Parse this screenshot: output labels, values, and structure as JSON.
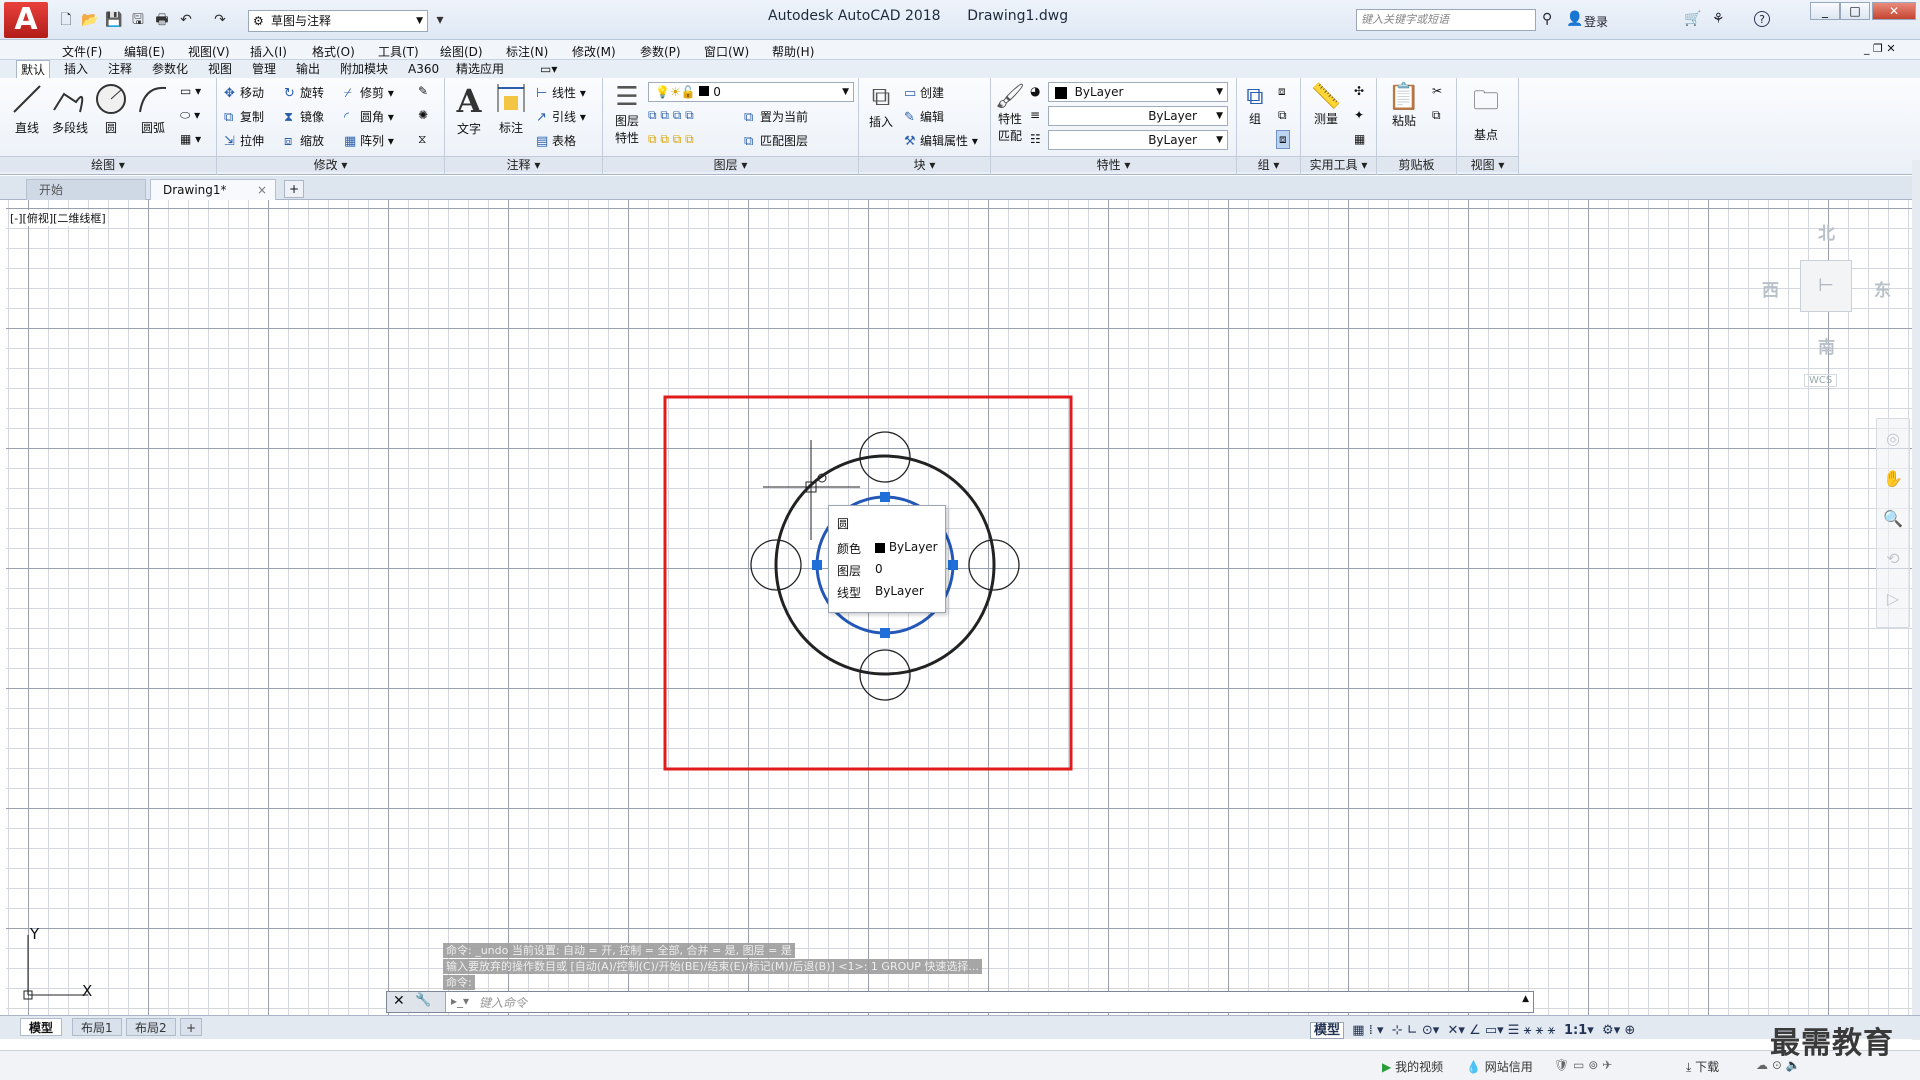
{
  "app": {
    "logo": "A",
    "title": "Autodesk AutoCAD 2018",
    "filename": "Drawing1.dwg",
    "workspace": "草图与注释",
    "search_placeholder": "键入关键字或短语",
    "login": "登录",
    "help": "?"
  },
  "menu": [
    "文件(F)",
    "编辑(E)",
    "视图(V)",
    "插入(I)",
    "格式(O)",
    "工具(T)",
    "绘图(D)",
    "标注(N)",
    "修改(M)",
    "参数(P)",
    "窗口(W)",
    "帮助(H)"
  ],
  "ribbon_tabs": [
    "默认",
    "插入",
    "注释",
    "参数化",
    "视图",
    "管理",
    "输出",
    "附加模块",
    "A360",
    "精选应用"
  ],
  "ribbon": {
    "draw": {
      "title": "绘图",
      "line": "直线",
      "polyline": "多段线",
      "circle": "圆",
      "arc": "圆弧"
    },
    "modify": {
      "title": "修改",
      "move": "移动",
      "rotate": "旋转",
      "trim": "修剪",
      "copy": "复制",
      "mirror": "镜像",
      "fillet": "圆角",
      "stretch": "拉伸",
      "scale": "缩放",
      "array": "阵列"
    },
    "annotation": {
      "title": "注释",
      "text": "文字",
      "dimension": "标注",
      "linear": "线性",
      "leader": "引线",
      "table": "表格"
    },
    "layers": {
      "title": "图层",
      "properties_line1": "图层",
      "properties_line2": "特性",
      "current_layer": "0",
      "make_current": "置为当前",
      "match_layer": "匹配图层"
    },
    "block": {
      "title": "块",
      "insert": "插入",
      "create": "创建",
      "edit": "编辑",
      "edit_attr": "编辑属性"
    },
    "properties": {
      "title": "特性",
      "match_line1": "特性",
      "match_line2": "匹配",
      "color": "ByLayer",
      "linetype": "ByLayer",
      "lineweight": "ByLayer"
    },
    "groups": {
      "title": "组",
      "group": "组"
    },
    "utilities": {
      "title": "实用工具",
      "measure": "测量"
    },
    "clipboard": {
      "title": "剪贴板",
      "paste": "粘贴"
    },
    "view": {
      "title": "视图",
      "base": "基点"
    }
  },
  "file_tabs": {
    "start": "开始",
    "drawing": "Drawing1*",
    "close": "×",
    "add": "+"
  },
  "viewport_label": "[-][俯视][二维线框]",
  "viewcube": {
    "north": "北",
    "south": "南",
    "east": "东",
    "west": "西",
    "wcs": "WCS"
  },
  "tooltip": {
    "title": "圆",
    "rows": [
      {
        "key": "颜色",
        "value": "ByLayer"
      },
      {
        "key": "图层",
        "value": "0"
      },
      {
        "key": "线型",
        "value": "ByLayer"
      }
    ]
  },
  "command": {
    "history": [
      "命令: _undo 当前设置: 自动 = 开, 控制 = 全部, 合并 = 是, 图层 = 是",
      "输入要放弃的操作数目或 [自动(A)/控制(C)/开始(BE)/结束(E)/标记(M)/后退(B)] <1>: 1 GROUP 快速选择...",
      "命令:"
    ],
    "placeholder": "键入命令"
  },
  "layout_tabs": [
    "模型",
    "布局1",
    "布局2"
  ],
  "status": {
    "model": "模型",
    "scale": "1:1"
  },
  "ucs": {
    "x": "X",
    "y": "Y"
  },
  "taskbar": {
    "video": "我的视频",
    "net": "网站信用",
    "download": "下载"
  },
  "watermark": "最需教育",
  "colors": {
    "selection_box": "#e11b1b",
    "grip": "#1f6fd8",
    "circle": "#222222",
    "selected_circle": "#2458b8"
  }
}
